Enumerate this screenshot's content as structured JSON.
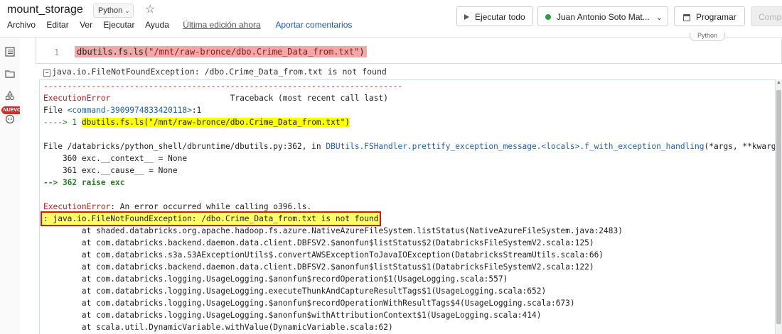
{
  "header": {
    "title": "mount_storage",
    "language": "Python",
    "menu": [
      "Archivo",
      "Editar",
      "Ver",
      "Ejecutar",
      "Ayuda"
    ],
    "last_edit": "Última edición ahora",
    "comments": "Aportar comentarios"
  },
  "toolbar": {
    "run_all": "Ejecutar todo",
    "cluster": "Juan Antonio Soto Mat...",
    "schedule": "Programar",
    "share": "Compa"
  },
  "sidebar": {
    "badge": "NUEVO"
  },
  "cell": {
    "language_tag": "Python",
    "line_number": "1",
    "code_prefix": "dbutils.fs.ls(",
    "code_string": "\"/mnt/raw-bronce/dbo.Crime_Data_from.txt\"",
    "code_suffix": ")"
  },
  "output": {
    "collapse_marker": "−",
    "exception_header": "java.io.FileNotFoundException: /dbo.Crime_Data_from.txt is not found",
    "separator": "---------------------------------------------------------------------------",
    "error_name": "ExecutionError",
    "traceback_label": "Traceback (most recent call last)",
    "file_prefix": "File ",
    "command_ref": "<command-3909974833420118>",
    "command_line": ":1",
    "arrow_line": "----> 1 ",
    "arrow_code": "dbutils.fs.ls(\"/mnt/raw-bronce/dbo.Crime_Data_from.txt\")",
    "file2_prefix": "File /databricks/python_shell/dbruntime/dbutils.py:362, in ",
    "file2_func": "DBUtils.FSHandler.prettify_exception_message.<locals>.f_with_exception_handling",
    "file2_args": "(*args, **kwargs)",
    "line360": "    360 exc.__context__ = None",
    "line361": "    361 exc.__cause__ = None",
    "line362": "--> 362 raise exc",
    "exec_error_name": "ExecutionError",
    "exec_error_msg": ": An error occurred while calling o396.ls.",
    "boxed_error": ": java.io.FileNotFoundException: /dbo.Crime_Data_from.txt is not found",
    "stack": [
      "        at shaded.databricks.org.apache.hadoop.fs.azure.NativeAzureFileSystem.listStatus(NativeAzureFileSystem.java:2483)",
      "        at com.databricks.backend.daemon.data.client.DBFSV2.$anonfun$listStatus$2(DatabricksFileSystemV2.scala:125)",
      "        at com.databricks.s3a.S3AExceptionUtils$.convertAWSExceptionToJavaIOException(DatabricksStreamUtils.scala:66)",
      "        at com.databricks.backend.daemon.data.client.DBFSV2.$anonfun$listStatus$1(DatabricksFileSystemV2.scala:122)",
      "        at com.databricks.logging.UsageLogging.$anonfun$recordOperation$1(UsageLogging.scala:557)",
      "        at com.databricks.logging.UsageLogging.executeThunkAndCaptureResultTags$1(UsageLogging.scala:652)",
      "        at com.databricks.logging.UsageLogging.$anonfun$recordOperationWithResultTags$4(UsageLogging.scala:673)",
      "        at com.databricks.logging.UsageLogging.$anonfun$withAttributionContext$1(UsageLogging.scala:414)",
      "        at scala.util.DynamicVariable.withValue(DynamicVariable.scala:62)"
    ]
  }
}
